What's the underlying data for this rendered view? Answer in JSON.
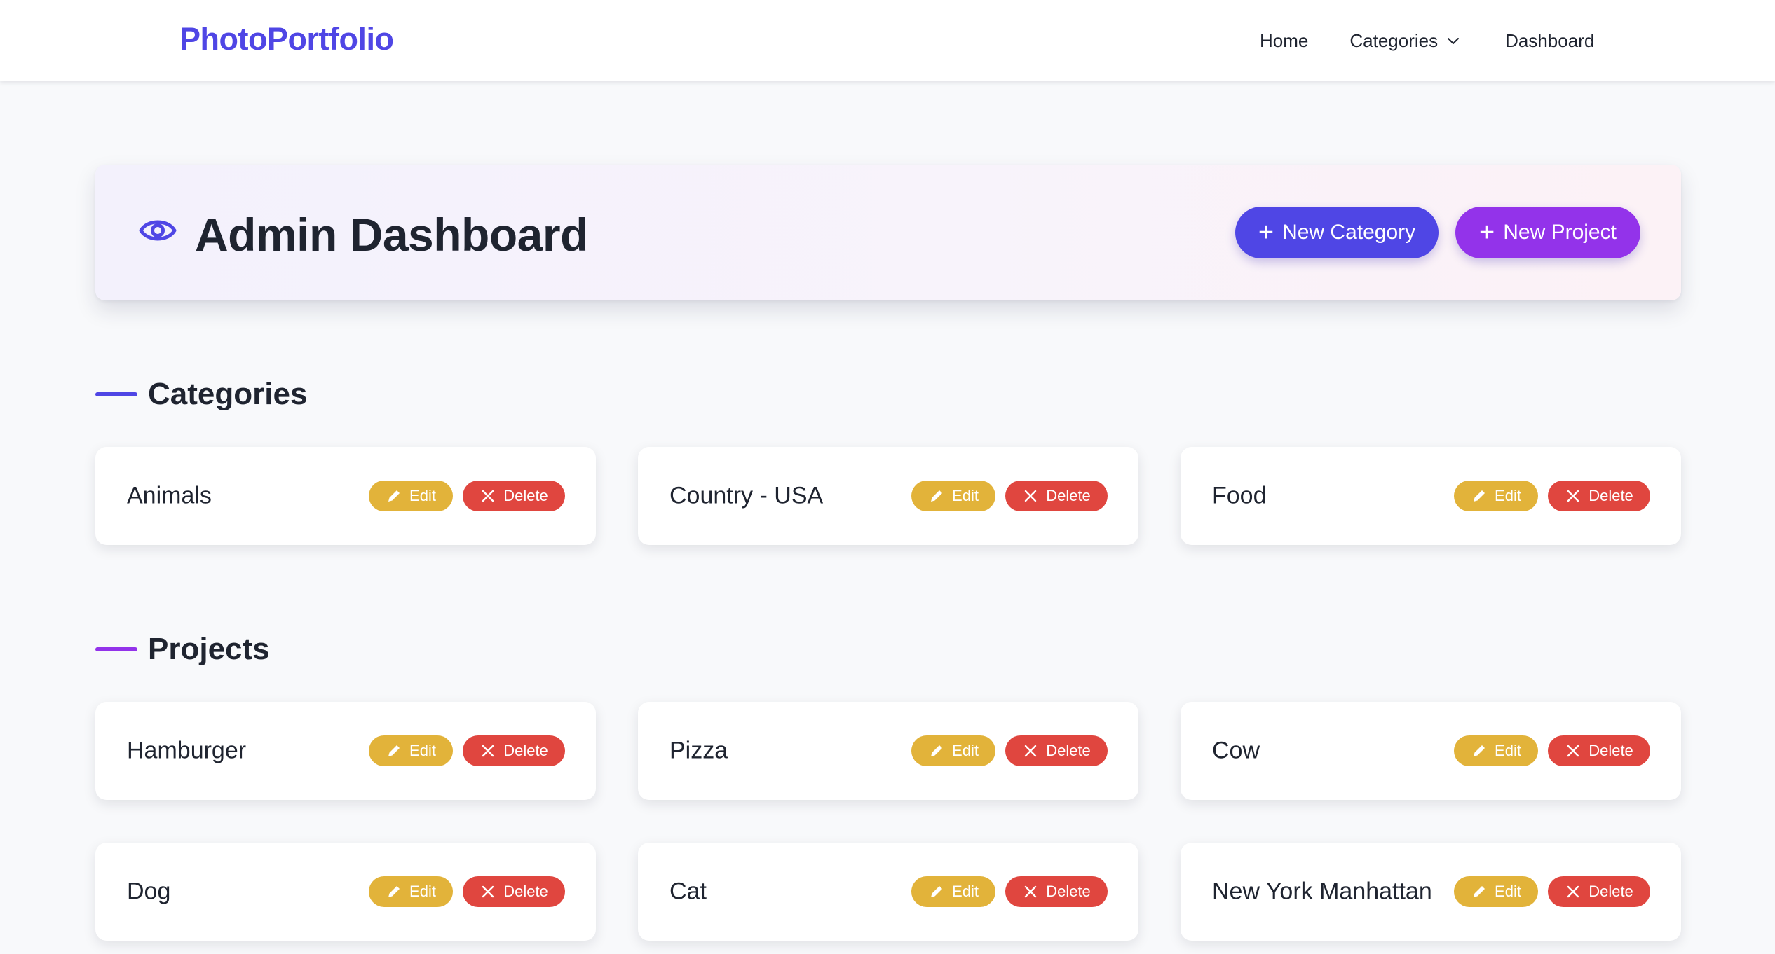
{
  "navbar": {
    "brand": "PhotoPortfolio",
    "links": {
      "home": "Home",
      "categories": "Categories",
      "dashboard": "Dashboard"
    }
  },
  "hero": {
    "title": "Admin Dashboard",
    "new_category_label": "New Category",
    "new_project_label": "New Project"
  },
  "categories_section": {
    "title": "Categories",
    "items": [
      {
        "label": "Animals"
      },
      {
        "label": "Country - USA"
      },
      {
        "label": "Food"
      }
    ]
  },
  "projects_section": {
    "title": "Projects",
    "items": [
      {
        "label": "Hamburger"
      },
      {
        "label": "Pizza"
      },
      {
        "label": "Cow"
      },
      {
        "label": "Dog"
      },
      {
        "label": "Cat"
      },
      {
        "label": "New York Manhattan"
      }
    ]
  },
  "actions": {
    "edit_label": "Edit",
    "delete_label": "Delete"
  },
  "icons": {
    "hero": "eye-icon",
    "categories_dropdown": "chevron-down-icon",
    "new_buttons": "plus-icon",
    "edit": "pencil-icon",
    "delete": "close-icon"
  },
  "colors": {
    "brand": "#4f46e5",
    "new_category_button": "#4f46e5",
    "new_project_button": "#9333ea",
    "edit_button": "#e2b33a",
    "delete_button": "#e0463f",
    "categories_accent": "#4f46e5",
    "projects_accent": "#9333ea"
  }
}
